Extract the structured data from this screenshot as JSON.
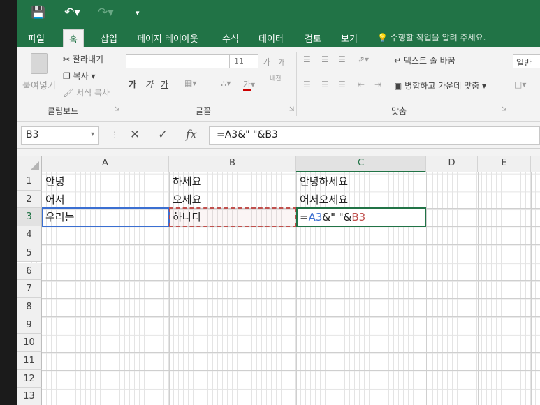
{
  "quick_access": {
    "save_icon": "save-icon",
    "undo_icon": "undo-icon",
    "redo_icon": "redo-icon",
    "customize_icon": "customize-icon"
  },
  "tabs": [
    {
      "label": "파일",
      "active": false
    },
    {
      "label": "홈",
      "active": true
    },
    {
      "label": "삽입",
      "active": false
    },
    {
      "label": "페이지 레이아웃",
      "active": false
    },
    {
      "label": "수식",
      "active": false
    },
    {
      "label": "데이터",
      "active": false
    },
    {
      "label": "검토",
      "active": false
    },
    {
      "label": "보기",
      "active": false
    }
  ],
  "tell_me": "수행할 작업을 알려 주세요.",
  "ribbon": {
    "clipboard": {
      "paste": "붙여넣기",
      "cut": "잘라내기",
      "copy": "복사",
      "format_painter": "서식 복사",
      "group_label": "클립보드"
    },
    "font": {
      "font_name": "",
      "font_size": "11",
      "grow": "가",
      "shrink": "가",
      "bold": "가",
      "italic": "가",
      "underline": "가",
      "text_color": "가",
      "phonetic": "내천",
      "group_label": "글꼴"
    },
    "alignment": {
      "wrap_text": "텍스트 줄 바꿈",
      "merge_center": "병합하고 가운데 맞춤",
      "group_label": "맞춤"
    },
    "number": {
      "format": "일반"
    }
  },
  "formula_bar": {
    "name_box": "B3",
    "cancel": "✕",
    "enter": "✓",
    "fx": "fx",
    "formula": "=A3&\" \"&B3"
  },
  "columns": [
    "A",
    "B",
    "C",
    "D",
    "E"
  ],
  "rows": [
    "1",
    "2",
    "3",
    "4",
    "5",
    "6",
    "7",
    "8",
    "9",
    "10",
    "11",
    "12",
    "13"
  ],
  "cells": {
    "A1": "안녕",
    "B1": "하세요",
    "C1": "안녕하세요",
    "A2": "어서",
    "B2": "오세요",
    "C2": "어서오세요",
    "A3": "우리는",
    "B3": "하나다",
    "C3_eq": "=",
    "C3_ref1": "A3",
    "C3_mid": "&\" \"&",
    "C3_ref2": "B3"
  },
  "colors": {
    "accent": "#217346",
    "ref_a": "#3b6fd1",
    "ref_b": "#c0504d"
  }
}
